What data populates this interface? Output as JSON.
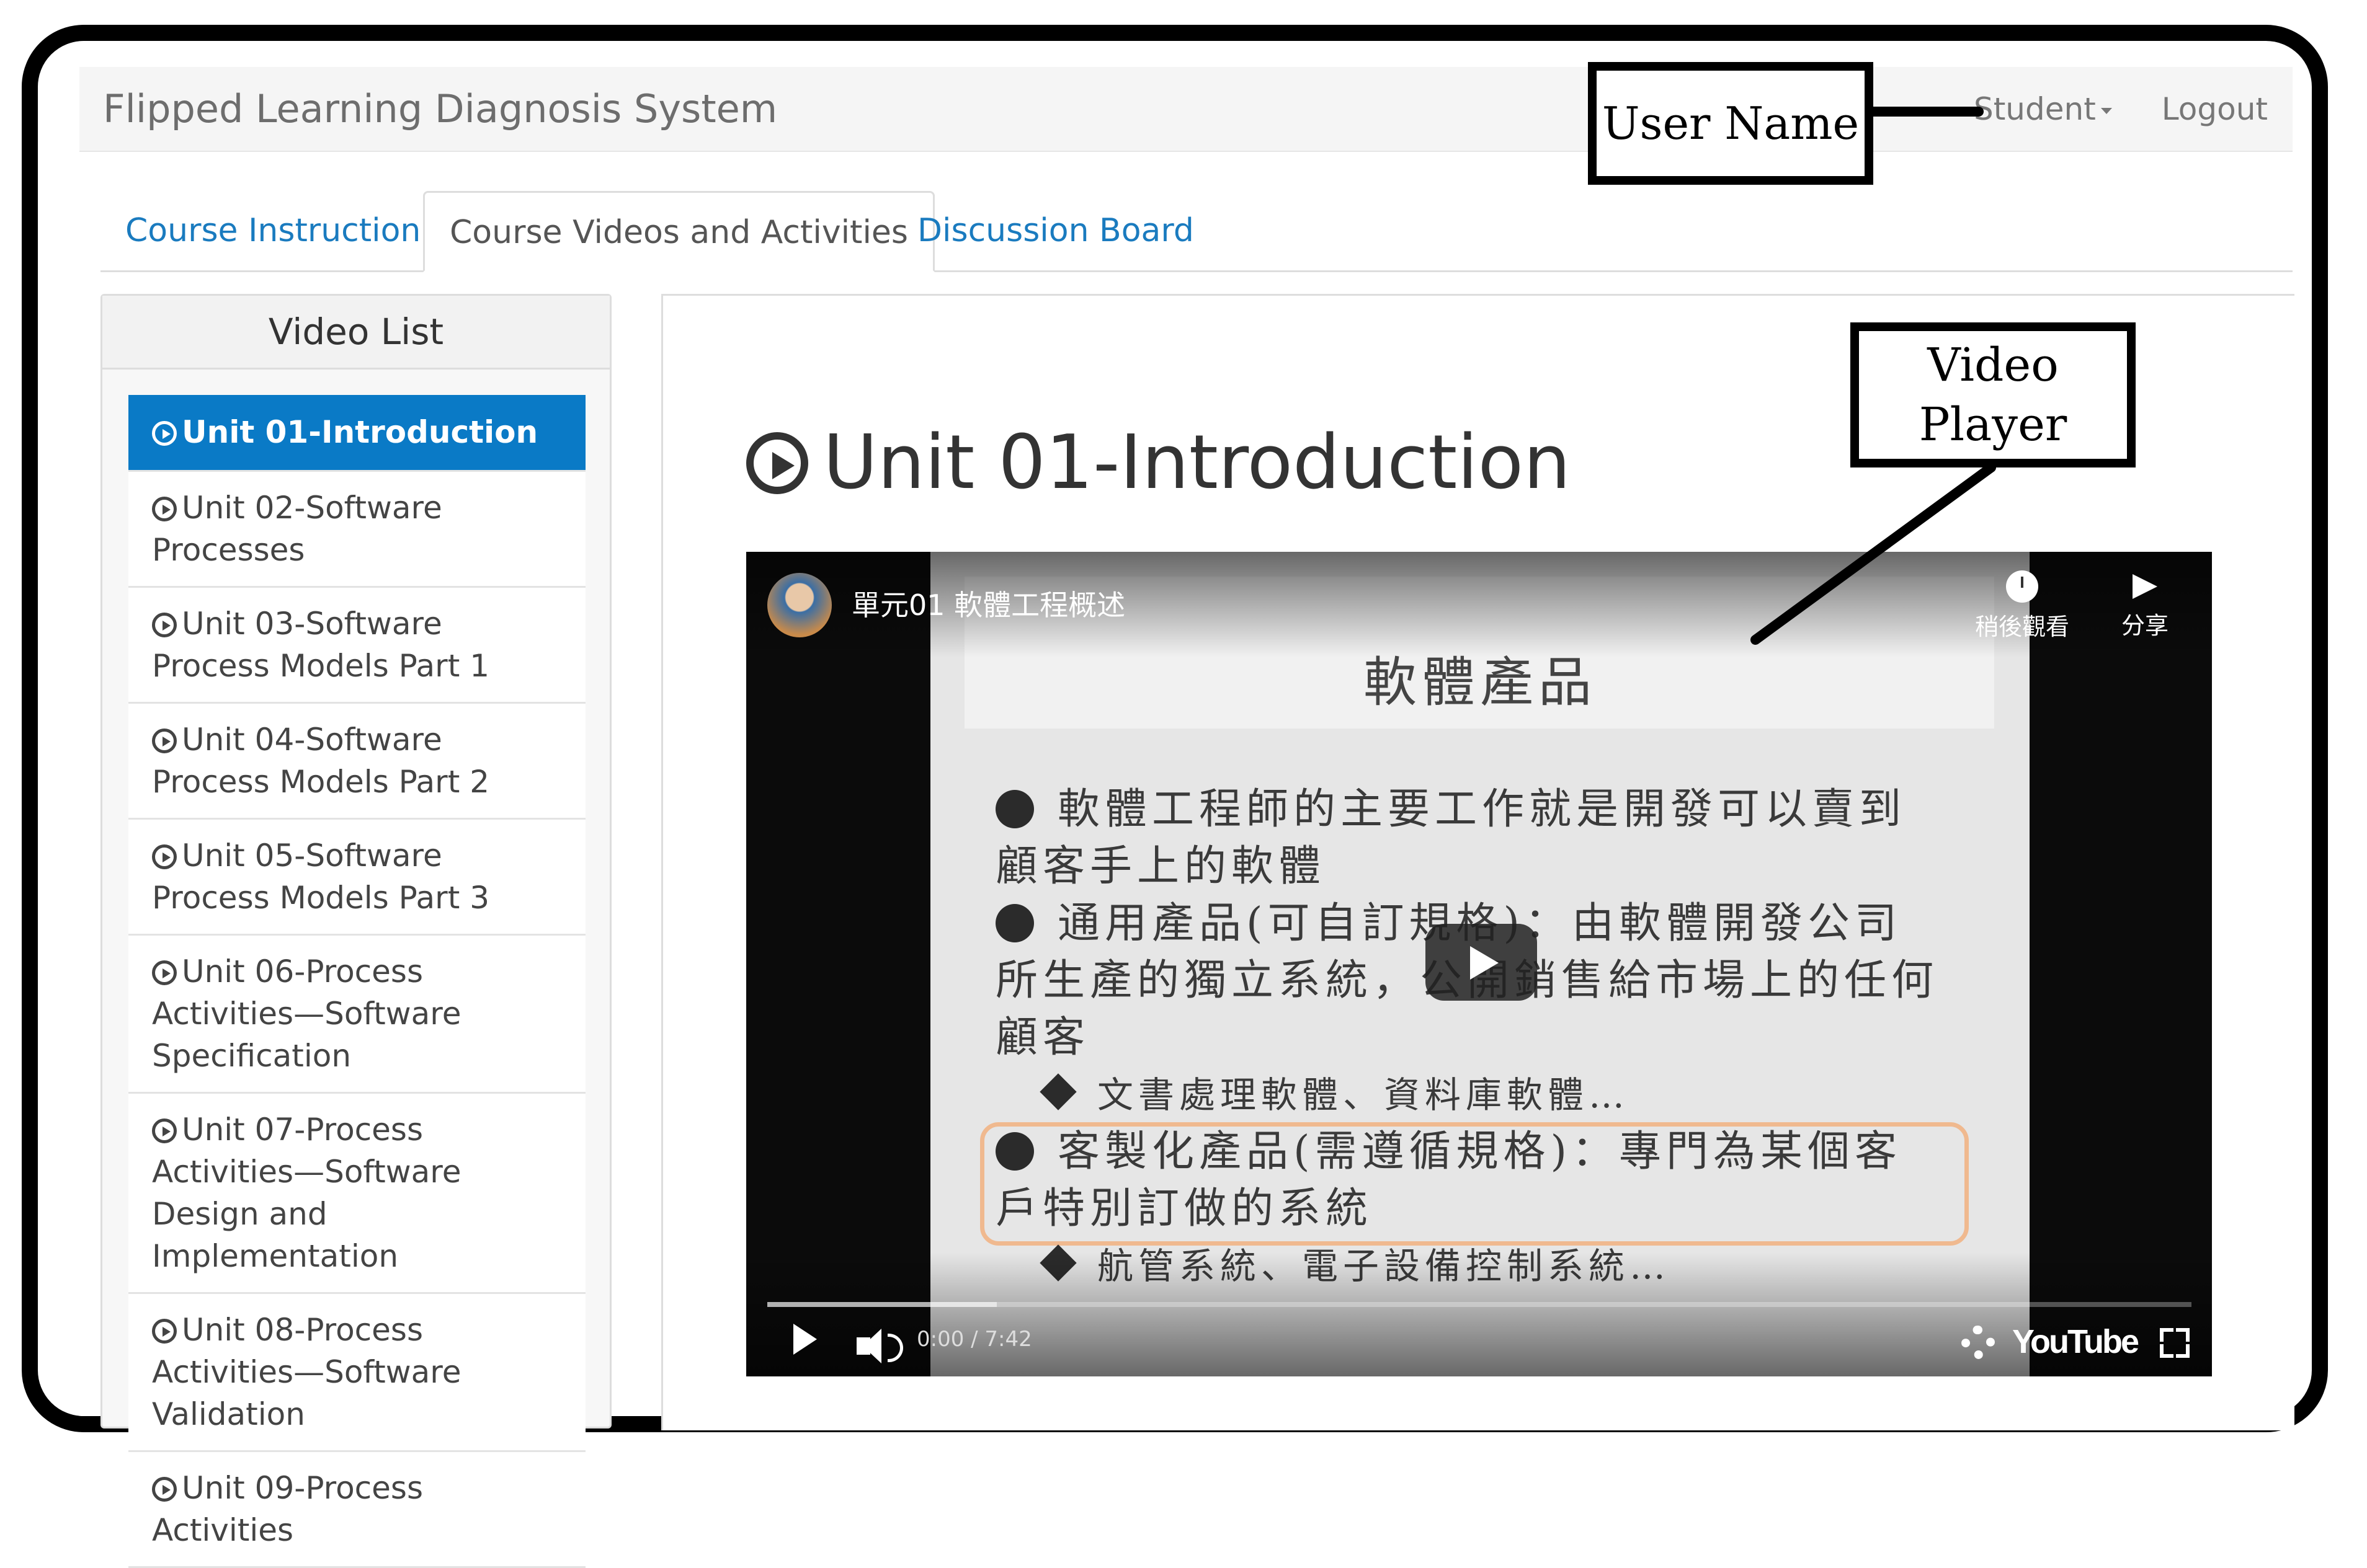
{
  "navbar": {
    "brand": "Flipped Learning Diagnosis System",
    "student_label": "Student",
    "logout_label": "Logout"
  },
  "tabs": [
    {
      "label": "Course Instruction",
      "active": false
    },
    {
      "label": "Course Videos and Activities",
      "active": true
    },
    {
      "label": "Discussion Board",
      "active": false
    }
  ],
  "sidebar": {
    "title": "Video List",
    "items": [
      {
        "label": "Unit 01-Introduction",
        "active": true
      },
      {
        "label": "Unit 02-Software Processes",
        "active": false
      },
      {
        "label": "Unit 03-Software Process Models Part 1",
        "active": false
      },
      {
        "label": "Unit 04-Software Process Models Part 2",
        "active": false
      },
      {
        "label": "Unit 05-Software Process Models Part 3",
        "active": false
      },
      {
        "label": "Unit 06-Process Activities—Software Specification",
        "active": false
      },
      {
        "label": "Unit 07-Process Activities—Software Design and Implementation",
        "active": false
      },
      {
        "label": "Unit 08-Process Activities—Software Validation",
        "active": false
      },
      {
        "label": "Unit 09-Process Activities",
        "active": false
      }
    ]
  },
  "main": {
    "title": "Unit 01-Introduction"
  },
  "video": {
    "title": "單元01 軟體工程概述",
    "watch_later": "稍後觀看",
    "share": "分享",
    "time": "0:00 / 7:42",
    "logo": "YouTube",
    "slide_heading": "軟體產品",
    "slide_lines": [
      "軟體工程師的主要工作就是開發可以賣到",
      "顧客手上的軟體",
      "通用產品(可自訂規格)：由軟體開發公司",
      "所生產的獨立系統，公開銷售給市場上的任何",
      "顧客",
      "文書處理軟體、資料庫軟體…",
      "客製化產品(需遵循規格)：專門為某個客",
      "戶特別訂做的系統",
      "航管系統、電子設備控制系統…"
    ],
    "progress": 0
  },
  "annotations": {
    "user_name": "User Name",
    "video_player_line1": "Video",
    "video_player_line2": "Player"
  },
  "colors": {
    "accent": "#0a7ac6",
    "link": "#1a7bbf",
    "highlight_border": "#f0b98f"
  }
}
